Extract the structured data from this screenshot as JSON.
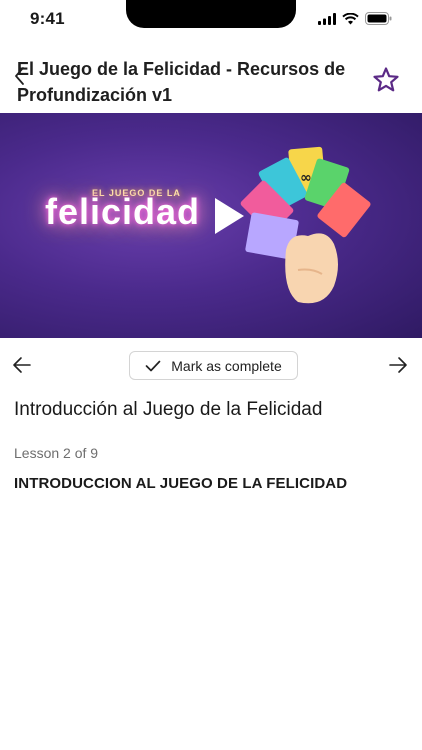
{
  "status_bar": {
    "time": "9:41"
  },
  "header": {
    "title": "El Juego de la Felicidad - Recursos de Profundización v1"
  },
  "video": {
    "brand_top": "EL JUEGO DE LA",
    "brand_main": "felicidad"
  },
  "actions": {
    "mark_complete_label": "Mark as complete"
  },
  "lesson": {
    "title": "Introducción al Juego de la Felicidad",
    "count": "Lesson 2 of 9",
    "heading": "INTRODUCCION AL JUEGO DE LA FELICIDAD"
  },
  "colors": {
    "accent": "#5b2a86",
    "video_bg": "#4b2a8c"
  },
  "icons": [
    "back-chevron-icon",
    "star-icon",
    "play-icon",
    "check-icon",
    "arrow-left-icon",
    "arrow-right-icon"
  ]
}
